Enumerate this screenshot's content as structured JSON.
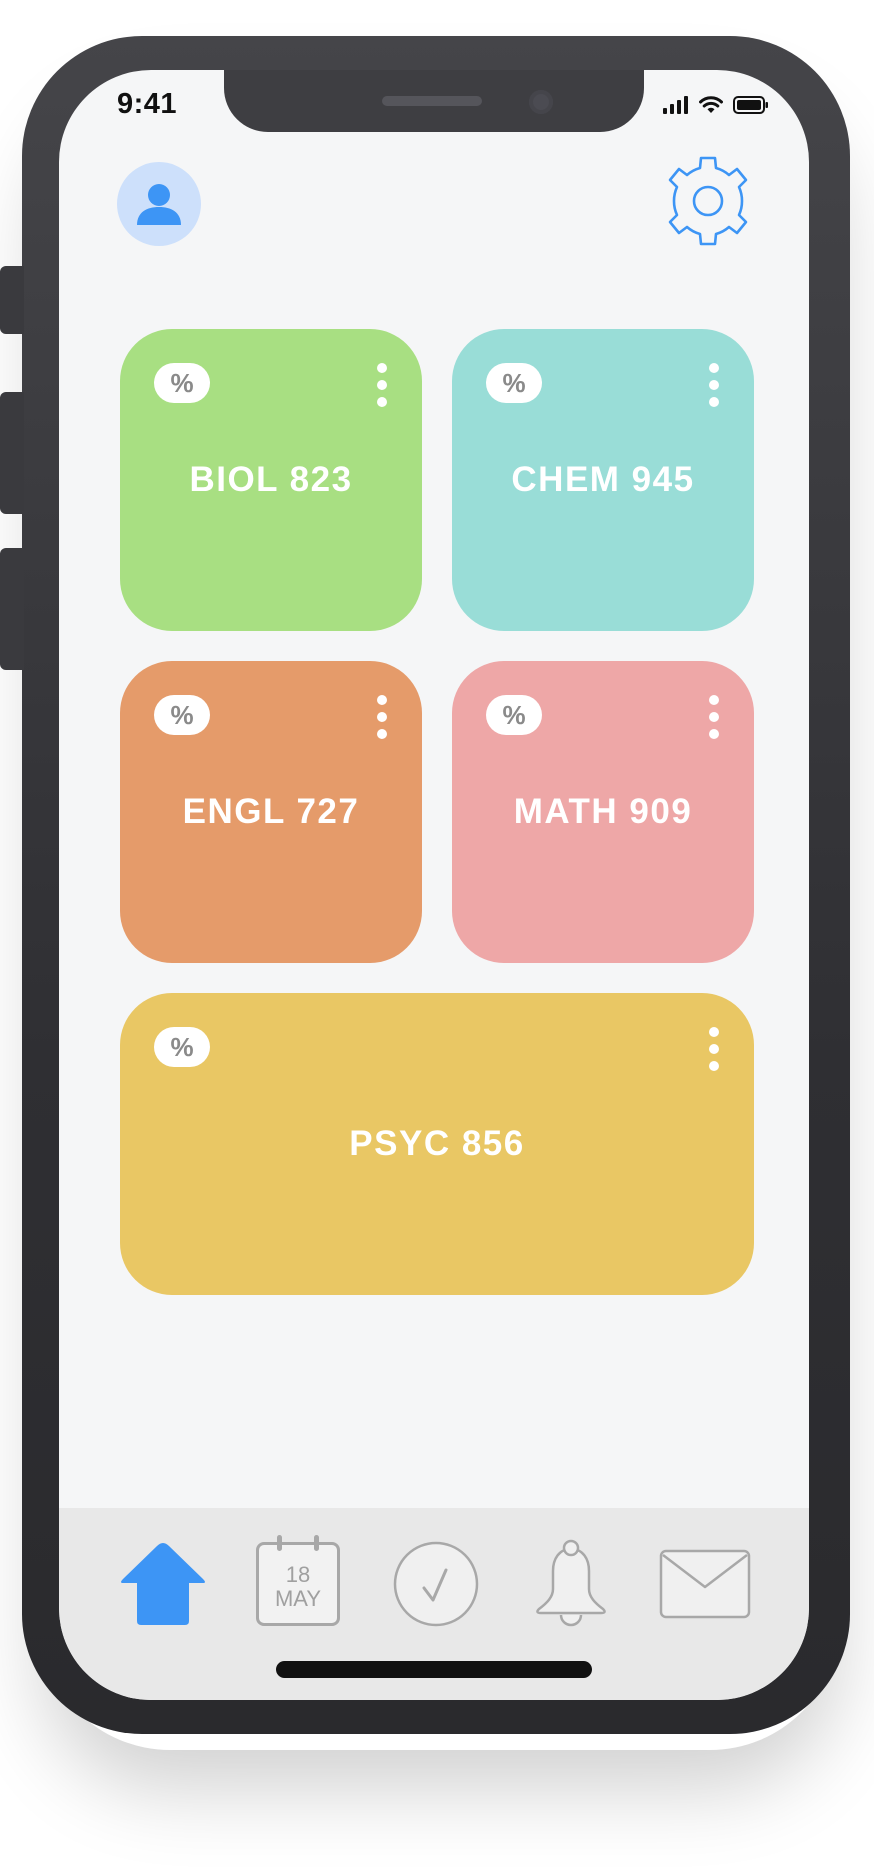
{
  "status_bar": {
    "time": "9:41"
  },
  "header": {
    "avatar_icon": "user-icon",
    "settings_icon": "gear-icon",
    "accent_color": "#3d95f5"
  },
  "courses": [
    {
      "name": "BIOL 823",
      "color": "#a8df82",
      "badge": "%"
    },
    {
      "name": "CHEM 945",
      "color": "#99ddd7",
      "badge": "%"
    },
    {
      "name": "ENGL 727",
      "color": "#e59b6a",
      "badge": "%"
    },
    {
      "name": "MATH 909",
      "color": "#eea7a7",
      "badge": "%"
    },
    {
      "name": "PSYC 856",
      "color": "#e9c764",
      "badge": "%"
    }
  ],
  "tab_bar": {
    "active_tab": "home",
    "tabs": [
      {
        "id": "home",
        "icon": "home-icon"
      },
      {
        "id": "calendar",
        "icon": "calendar-icon",
        "day": "18",
        "month": "MAY"
      },
      {
        "id": "tasks",
        "icon": "check-icon"
      },
      {
        "id": "notifications",
        "icon": "bell-icon"
      },
      {
        "id": "messages",
        "icon": "envelope-icon"
      }
    ]
  }
}
